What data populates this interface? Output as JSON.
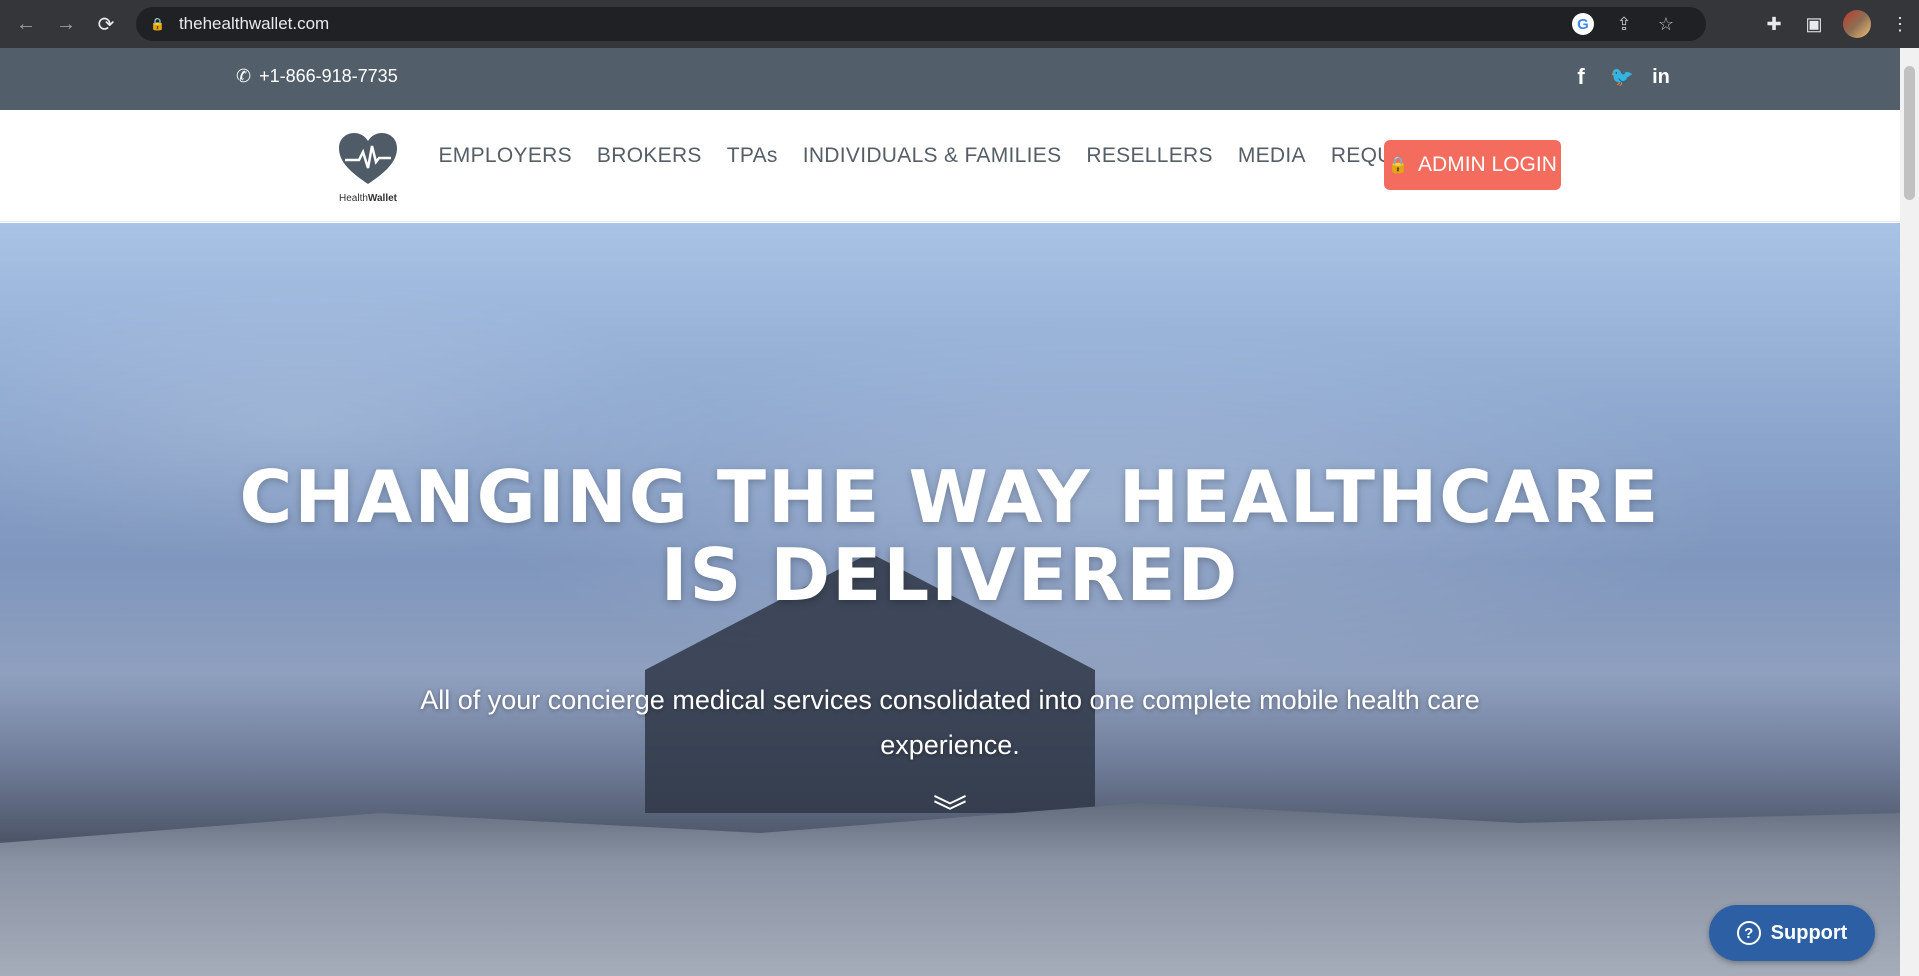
{
  "browser": {
    "url": "thehealthwallet.com",
    "back_icon": "←",
    "forward_icon": "→",
    "reload_icon": "⟳",
    "lock_icon": "🔒",
    "google_icon": "G",
    "share_icon": "⇪",
    "star_icon": "☆",
    "extensions_icon": "✚",
    "sidebar_icon": "▣",
    "menu_icon": "⋮"
  },
  "topbar": {
    "phone_icon": "✆",
    "phone": "+1-866-918-7735",
    "socials": [
      {
        "name": "facebook",
        "glyph": "f"
      },
      {
        "name": "twitter",
        "glyph": "🐦"
      },
      {
        "name": "linkedin",
        "glyph": "in"
      }
    ]
  },
  "header": {
    "logo_text_light": "Health",
    "logo_text_bold": "Wallet",
    "menu": [
      "EMPLOYERS",
      "BROKERS",
      "TPAs",
      "INDIVIDUALS & FAMILIES",
      "RESELLERS",
      "MEDIA",
      "REQUEST DEMO"
    ],
    "admin_login": "ADMIN LOGIN",
    "admin_icon": "🔒"
  },
  "hero": {
    "title_line1": "CHANGING THE WAY HEALTHCARE",
    "title_line2": "IS DELIVERED",
    "subtitle": "All of your concierge medical services consolidated into one complete mobile health care experience.",
    "scroll_icon": "︾"
  },
  "support": {
    "icon": "?",
    "label": "Support"
  },
  "colors": {
    "topbar": "#525e6a",
    "accent": "#f36c5e",
    "support": "#2d5fa4"
  }
}
